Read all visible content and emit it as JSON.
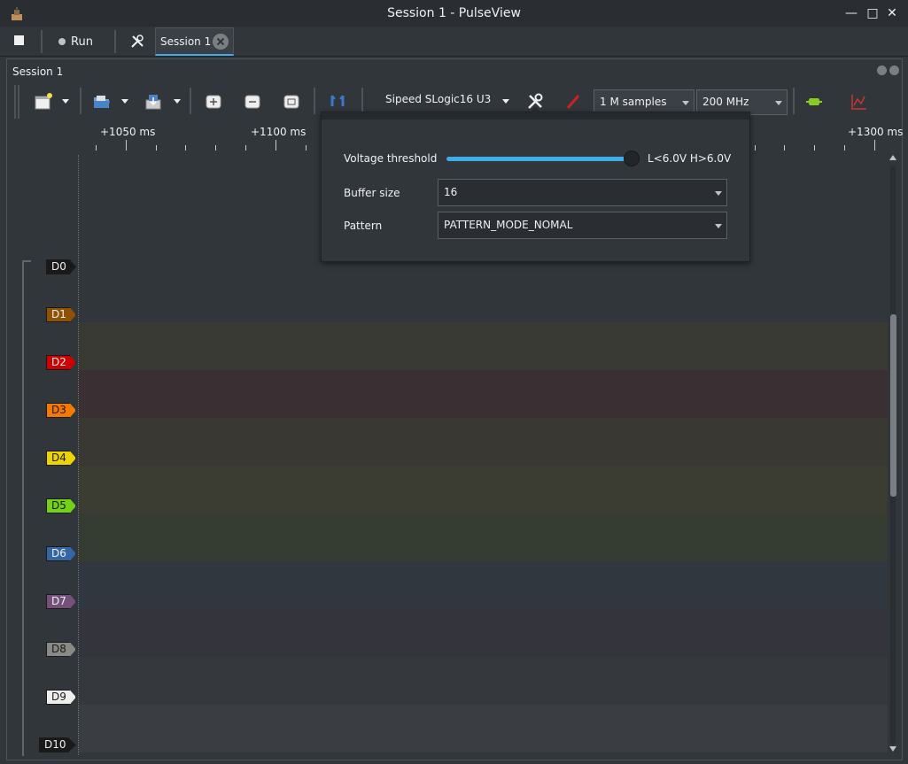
{
  "window": {
    "title": "Session 1 - PulseView",
    "minimize_glyph": "—",
    "maximize_glyph": "□",
    "close_glyph": "✕"
  },
  "main_tabs": {
    "run_label": "Run",
    "session_tab_label": "Session 1"
  },
  "session": {
    "title": "Session 1"
  },
  "toolbar": {
    "device": "Sipeed SLogic16 U3",
    "samples": "1 M samples",
    "samplerate": "200 MHz"
  },
  "ruler": {
    "labels": [
      "+1050 ms",
      "+1100 ms",
      "+1300 ms"
    ]
  },
  "channels": [
    {
      "name": "D0",
      "color": "#1a1a1a",
      "text_color": "#eff0f1",
      "band": "#31363b"
    },
    {
      "name": "D1",
      "color": "#8f5202",
      "text_color": "#eff0f1",
      "band": "#3a3a34"
    },
    {
      "name": "D2",
      "color": "#cc0000",
      "text_color": "#eff0f1",
      "band": "#3a3034"
    },
    {
      "name": "D3",
      "color": "#f57900",
      "text_color": "#1a1a1a",
      "band": "#3a3832"
    },
    {
      "name": "D4",
      "color": "#edd400",
      "text_color": "#1a1a1a",
      "band": "#3b3d32"
    },
    {
      "name": "D5",
      "color": "#73d216",
      "text_color": "#1a1a1a",
      "band": "#353d32"
    },
    {
      "name": "D6",
      "color": "#3465a4",
      "text_color": "#eff0f1",
      "band": "#30373e"
    },
    {
      "name": "D7",
      "color": "#75507b",
      "text_color": "#eff0f1",
      "band": "#33343c"
    },
    {
      "name": "D8",
      "color": "#888a85",
      "text_color": "#1a1a1a",
      "band": "#35393d"
    },
    {
      "name": "D9",
      "color": "#eeeeec",
      "text_color": "#1a1a1a",
      "band": "#3a3e42"
    },
    {
      "name": "D10",
      "color": "#1a1a1a",
      "text_color": "#eff0f1",
      "band": "#31363b"
    }
  ],
  "popup": {
    "voltage_label": "Voltage threshold",
    "voltage_value": "L<6.0V H>6.0V",
    "voltage_level": 1.0,
    "buffer_label": "Buffer size",
    "buffer_value": "16",
    "pattern_label": "Pattern",
    "pattern_value": "PATTERN_MODE_NOMAL"
  },
  "icons": {
    "app": "pulseview-app-icon",
    "stop": "stop-icon",
    "tools": "tools-icon",
    "new": "new-view-icon",
    "open": "open-file-icon",
    "save": "save-file-icon",
    "zoom_in": "zoom-in-icon",
    "zoom_out": "zoom-out-icon",
    "zoom_fit": "zoom-fit-icon",
    "cursor": "cursor-icon",
    "config": "device-config-icon",
    "probe": "probe-icon",
    "decoder": "add-decoder-icon",
    "math": "add-math-icon"
  },
  "colors": {
    "accent": "#3daee9",
    "background": "#31363b",
    "titlebar": "#2a2e32"
  }
}
